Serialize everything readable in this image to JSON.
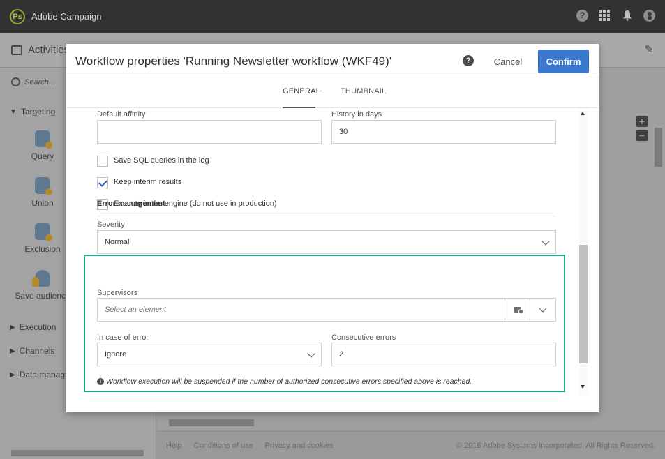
{
  "app": {
    "title": "Adobe Campaign",
    "logo_glyph": "Ps"
  },
  "workspace": {
    "header_title": "Activities",
    "search_placeholder": "Search...",
    "sections": {
      "targeting": "Targeting",
      "execution": "Execution",
      "channels": "Channels",
      "data_management": "Data manage"
    },
    "activities": [
      {
        "label": "Query",
        "icon": "database-icon"
      },
      {
        "label": "Union",
        "icon": "database-icon"
      },
      {
        "label": "Exclusion",
        "icon": "database-icon"
      },
      {
        "label": "Save audience",
        "icon": "people-icon"
      }
    ],
    "footer": {
      "help": "Help",
      "conditions": "Conditions of use",
      "privacy": "Privacy and cookies",
      "copyright": "© 2016 Adobe Systems Incorporated. All Rights Reserved."
    }
  },
  "modal": {
    "title": "Workflow properties 'Running Newsletter workflow (WKF49)'",
    "cancel_label": "Cancel",
    "confirm_label": "Confirm",
    "tabs": {
      "general": "GENERAL",
      "thumbnail": "THUMBNAIL"
    },
    "fields": {
      "default_affinity_label": "Default affinity",
      "default_affinity_value": "",
      "history_label": "History in days",
      "history_value": "30",
      "save_sql_label": "Save SQL queries in the log",
      "save_sql_checked": false,
      "keep_interim_label": "Keep interim results",
      "keep_interim_checked": true,
      "execute_engine_label": "Execute in the engine (do not use in production)",
      "execute_engine_checked": false,
      "severity_label": "Severity",
      "severity_value": "Normal"
    },
    "error_management": {
      "title": "Error management",
      "supervisors_label": "Supervisors",
      "supervisors_placeholder": "Select an element",
      "in_case_label": "In case of error",
      "in_case_value": "Ignore",
      "consecutive_label": "Consecutive errors",
      "consecutive_value": "2",
      "info_text": "Workflow execution will be suspended if the number of authorized consecutive errors specified above is reached.",
      "highlight_color": "#1eaa8f"
    }
  },
  "colors": {
    "topbar": "#323232",
    "confirm": "#3a79cf"
  }
}
